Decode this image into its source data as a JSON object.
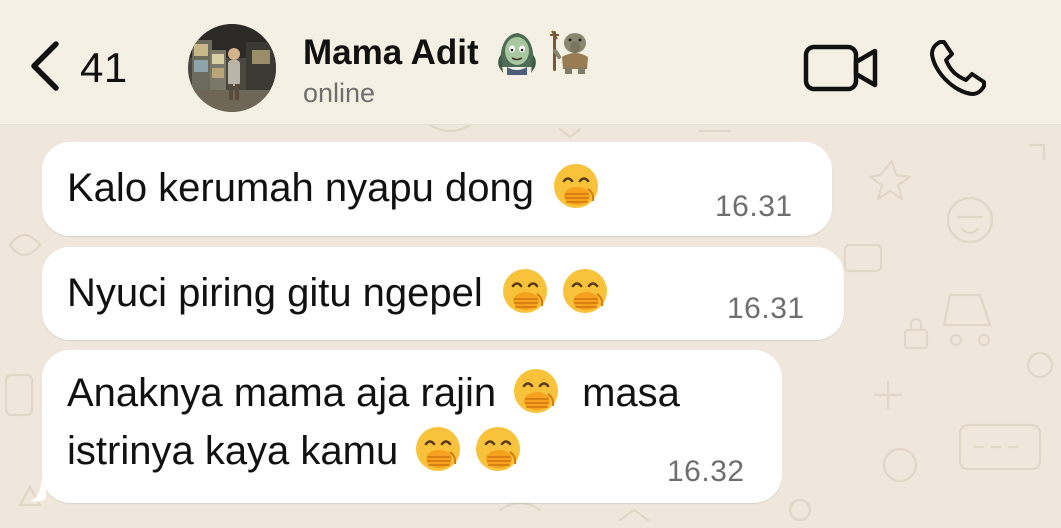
{
  "header": {
    "back_count": "41",
    "contact_name": "Mama Adit",
    "status": "online",
    "emojis": [
      "zombie-woman-emoji",
      "troll-emoji"
    ],
    "icons": {
      "back": "chevron-left-icon",
      "video": "video-camera-icon",
      "call": "phone-icon"
    }
  },
  "messages": [
    {
      "parts": [
        "Kalo kerumah nyapu dong"
      ],
      "emoji_after": [
        "face-with-hand-over-mouth"
      ],
      "time": "16.31"
    },
    {
      "parts": [
        "Nyuci piring gitu ngepel"
      ],
      "emoji_after": [
        "face-with-hand-over-mouth",
        "face-with-hand-over-mouth"
      ],
      "time": "16.31"
    },
    {
      "line1": "Anaknya mama aja rajin",
      "line1_after_emoji": "masa",
      "line2": "istrinya kaya kamu",
      "emoji_after": [
        "face-with-hand-over-mouth",
        "face-with-hand-over-mouth"
      ],
      "time": "16.32"
    }
  ],
  "colors": {
    "header_bg": "#f4f1e4",
    "chat_bg": "#efe7dc",
    "bubble_bg": "#ffffff",
    "text": "#111111",
    "timestamp": "#6e6e6e"
  }
}
